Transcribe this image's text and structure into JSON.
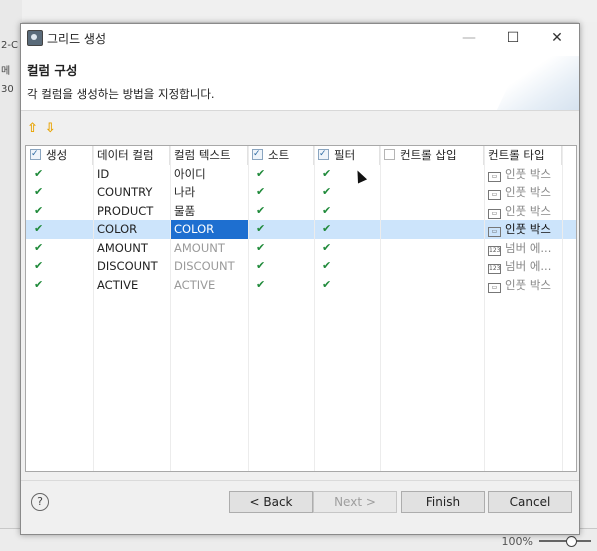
{
  "background": {
    "left_fragments": [
      "2-C",
      "메",
      "30"
    ],
    "zoom_label": "100%"
  },
  "dialog": {
    "title": "그리드 생성",
    "header": {
      "title": "컬럼 구성",
      "description": "각 컬럼을 생성하는 방법을 지정합니다."
    },
    "toolbar": {
      "up_icon": "arrow-up-icon",
      "down_icon": "arrow-down-icon",
      "up_glyph": "⇧",
      "down_glyph": "⇩"
    },
    "table": {
      "headers": [
        "생성",
        "데이터 컬럼",
        "컬럼 텍스트",
        "소트",
        "필터",
        "컨트롤 삽입",
        "컨트롤 타입"
      ],
      "rows": [
        {
          "create": "✔",
          "data_column": "ID",
          "column_text": "아이디",
          "sort": "✔",
          "filter": "✔",
          "insert": "",
          "control_type": "인풋 박스",
          "control_icon": "▭"
        },
        {
          "create": "✔",
          "data_column": "COUNTRY",
          "column_text": "나라",
          "sort": "✔",
          "filter": "✔",
          "insert": "",
          "control_type": "인풋 박스",
          "control_icon": "▭"
        },
        {
          "create": "✔",
          "data_column": "PRODUCT",
          "column_text": "물품",
          "sort": "✔",
          "filter": "✔",
          "insert": "",
          "control_type": "인풋 박스",
          "control_icon": "▭"
        },
        {
          "create": "✔",
          "data_column": "COLOR",
          "column_text": "COLOR",
          "sort": "✔",
          "filter": "✔",
          "insert": "",
          "control_type": "인풋 박스",
          "control_icon": "▭"
        },
        {
          "create": "✔",
          "data_column": "AMOUNT",
          "column_text": "AMOUNT",
          "sort": "✔",
          "filter": "✔",
          "insert": "",
          "control_type": "넘버 에...",
          "control_icon": "123"
        },
        {
          "create": "✔",
          "data_column": "DISCOUNT",
          "column_text": "DISCOUNT",
          "sort": "✔",
          "filter": "✔",
          "insert": "",
          "control_type": "넘버 에...",
          "control_icon": "123"
        },
        {
          "create": "✔",
          "data_column": "ACTIVE",
          "column_text": "ACTIVE",
          "sort": "✔",
          "filter": "✔",
          "insert": "",
          "control_type": "인풋 박스",
          "control_icon": "▭"
        }
      ]
    },
    "buttons": {
      "help": "?",
      "back": "< Back",
      "next": "Next >",
      "finish": "Finish",
      "cancel": "Cancel"
    },
    "window_controls": {
      "minimize": "—",
      "maximize": "☐",
      "close": "✕"
    }
  }
}
